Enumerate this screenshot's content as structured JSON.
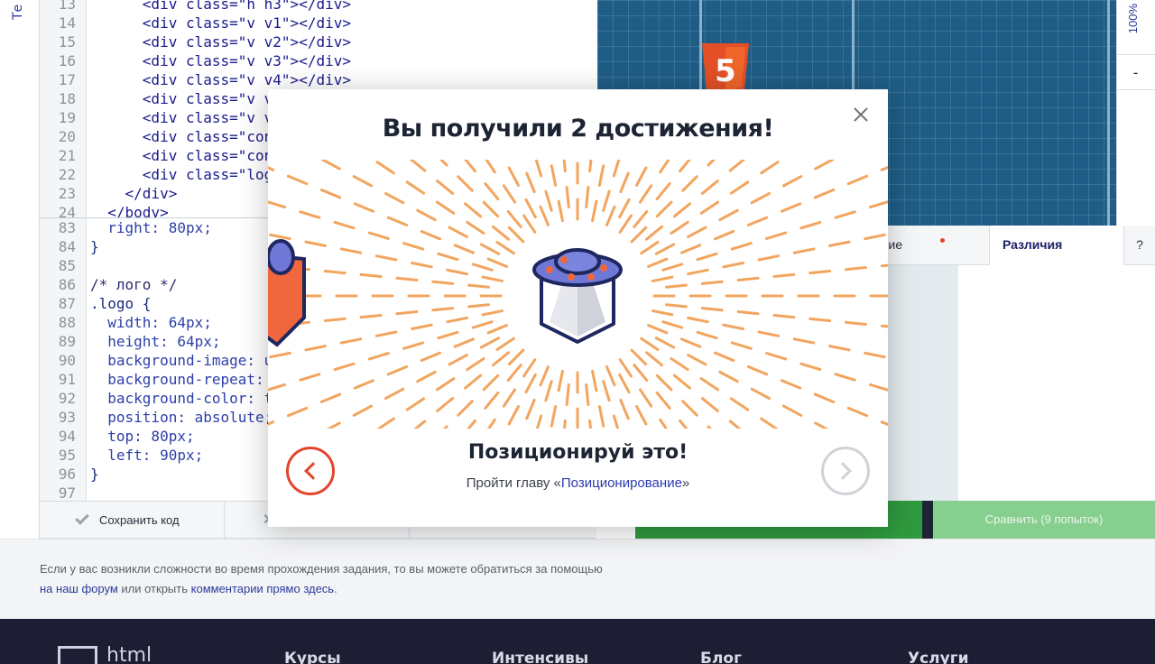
{
  "left_tab": {
    "label": "Те"
  },
  "html_editor": {
    "lines": [
      {
        "n": "13",
        "code": "      <div class=\"h h3\"></div>"
      },
      {
        "n": "14",
        "code": "      <div class=\"v v1\"></div>"
      },
      {
        "n": "15",
        "code": "      <div class=\"v v2\"></div>"
      },
      {
        "n": "16",
        "code": "      <div class=\"v v3\"></div>"
      },
      {
        "n": "17",
        "code": "      <div class=\"v v4\"></div>"
      },
      {
        "n": "18",
        "code": "      <div class=\"v v"
      },
      {
        "n": "19",
        "code": "      <div class=\"v v"
      },
      {
        "n": "20",
        "code": "      <div class=\"con"
      },
      {
        "n": "21",
        "code": "      <div class=\"con"
      },
      {
        "n": "22",
        "code": "      <div class=\"log"
      },
      {
        "n": "23",
        "code": "    </div>"
      },
      {
        "n": "24",
        "code": "  </body>"
      }
    ]
  },
  "css_editor": {
    "lines": [
      {
        "n": "83",
        "code": "  right: 80px;"
      },
      {
        "n": "84",
        "code": "}"
      },
      {
        "n": "85",
        "code": ""
      },
      {
        "n": "86",
        "code": "/* лого */"
      },
      {
        "n": "87",
        "code": ".logo {"
      },
      {
        "n": "88",
        "code": "  width: 64px;"
      },
      {
        "n": "89",
        "code": "  height: 64px;"
      },
      {
        "n": "90",
        "code": "  background-image: u"
      },
      {
        "n": "91",
        "code": "  background-repeat:"
      },
      {
        "n": "92",
        "code": "  background-color: t"
      },
      {
        "n": "93",
        "code": "  position: absolute;"
      },
      {
        "n": "94",
        "code": "  top: 80px;"
      },
      {
        "n": "95",
        "code": "  left: 90px;"
      },
      {
        "n": "96",
        "code": "}"
      },
      {
        "n": "97",
        "code": ""
      }
    ]
  },
  "editor_toolbar": {
    "save_label": "Сохранить код"
  },
  "preview": {
    "zoom_label": "100%",
    "zoom_minus": "-"
  },
  "tabs": {
    "image_label": "ожение",
    "diff_label": "Различия",
    "help_label": "?"
  },
  "actions": {
    "compare_label": "Сравнить (9 попыток)"
  },
  "help": {
    "text_before": "Если у вас возникли сложности во время прохождения задания, то вы можете обратиться за помощью ",
    "forum_link": "на наш форум",
    "text_middle": " или открыть ",
    "comments_link": "комментарии прямо здесь",
    "text_end": "."
  },
  "footer": {
    "logo_text": "html",
    "columns": [
      "Курсы",
      "Интенсивы",
      "Блог",
      "Услуги"
    ]
  },
  "modal": {
    "title": "Вы получили 2 достижения!",
    "achievement_title": "Позиционируй это!",
    "desc_prefix": "Пройти главу «",
    "desc_link": "Позиционирование",
    "desc_suffix": "»"
  },
  "colors": {
    "accent_red": "#e2452c",
    "burst_orange": "#f2a55e",
    "link_blue": "#2b3ab0",
    "green": "#2f9a3e"
  }
}
